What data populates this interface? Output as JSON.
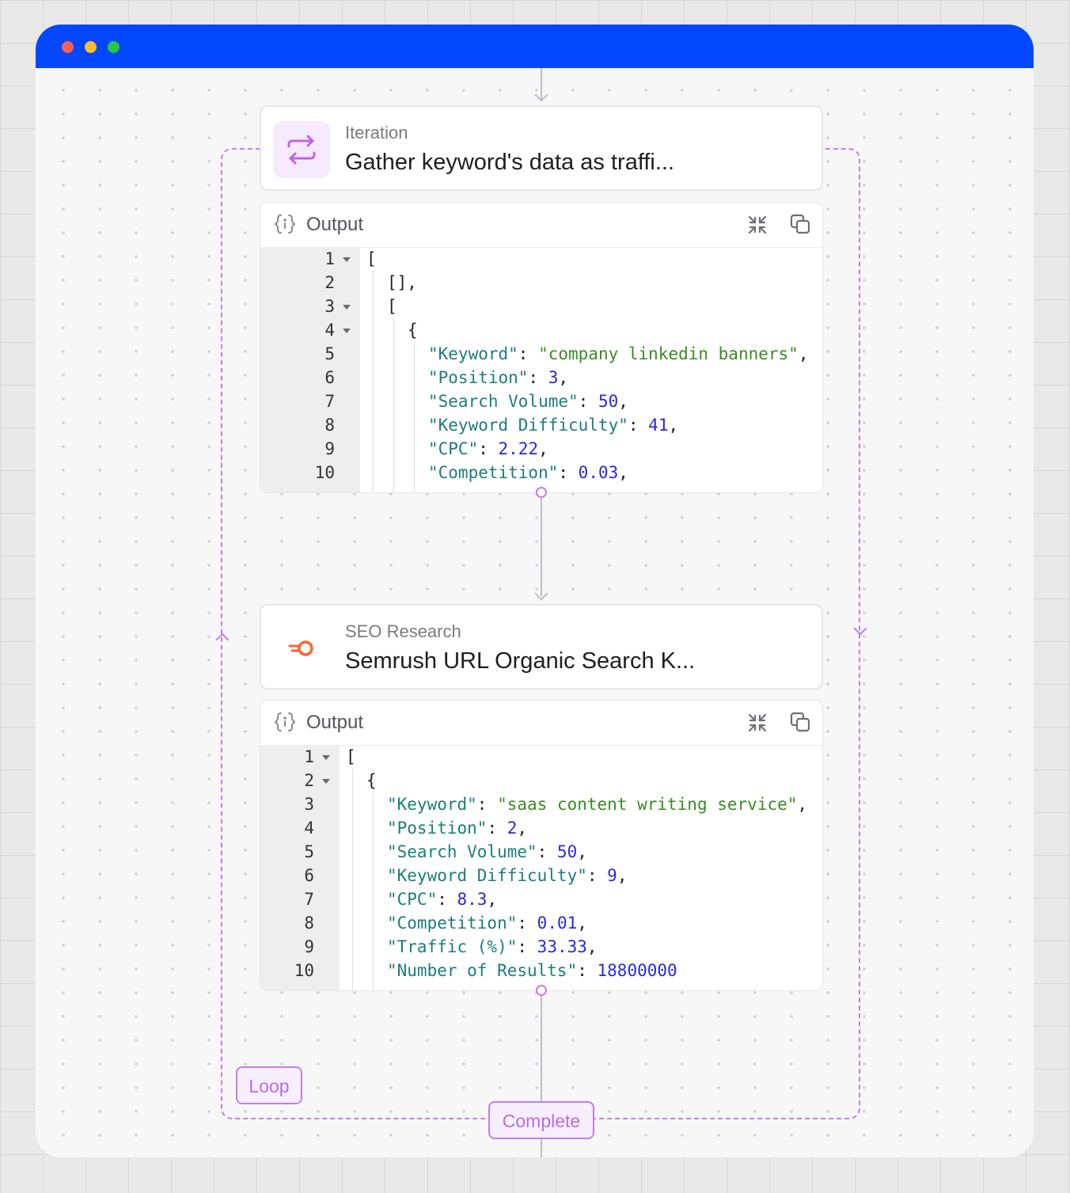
{
  "window": {
    "controls": [
      "close",
      "minimize",
      "maximize"
    ],
    "titlebar_color": "#0347ff"
  },
  "colors": {
    "loop_accent": "#c57cf0",
    "iteration_icon_bg": "#f6ebfe",
    "semrush_orange": "#ff642d",
    "json_key": "#1c7c7c",
    "json_string": "#3a8a23",
    "json_number": "#2a28d8"
  },
  "iteration_node": {
    "subtitle": "Iteration",
    "title": "Gather keyword's data as traffi...",
    "icon": "repeat-arrows-icon"
  },
  "iteration_output": {
    "label": "Output",
    "icons": [
      "json-object-icon",
      "collapse-icon",
      "copy-icon"
    ],
    "line_numbers": [
      "1",
      "2",
      "3",
      "4",
      "5",
      "6",
      "7",
      "8",
      "9",
      "10"
    ],
    "code": {
      "open_array": "[",
      "empty_array": "[],",
      "inner_array_open": "[",
      "object_open": "{",
      "k1": "\"Keyword\"",
      "v1": "\"company linkedin banners\"",
      "k2": "\"Position\"",
      "v2": "3",
      "k3": "\"Search Volume\"",
      "v3": "50",
      "k4": "\"Keyword Difficulty\"",
      "v4": "41",
      "k5": "\"CPC\"",
      "v5": "2.22",
      "k6": "\"Competition\"",
      "v6": "0.03"
    }
  },
  "seo_node": {
    "subtitle": "SEO Research",
    "title": "Semrush URL Organic Search K...",
    "icon": "semrush-icon"
  },
  "seo_output": {
    "label": "Output",
    "icons": [
      "json-object-icon",
      "collapse-icon",
      "copy-icon"
    ],
    "line_numbers": [
      "1",
      "2",
      "3",
      "4",
      "5",
      "6",
      "7",
      "8",
      "9",
      "10"
    ],
    "code": {
      "open_array": "[",
      "object_open": "{",
      "k1": "\"Keyword\"",
      "v1": "\"saas content writing service\"",
      "k2": "\"Position\"",
      "v2": "2",
      "k3": "\"Search Volume\"",
      "v3": "50",
      "k4": "\"Keyword Difficulty\"",
      "v4": "9",
      "k5": "\"CPC\"",
      "v5": "8.3",
      "k6": "\"Competition\"",
      "v6": "0.01",
      "k7": "\"Traffic (%)\"",
      "v7": "33.33",
      "k8": "\"Number of Results\"",
      "v8": "18800000"
    }
  },
  "loop_tag": "Loop",
  "complete_tag": "Complete"
}
